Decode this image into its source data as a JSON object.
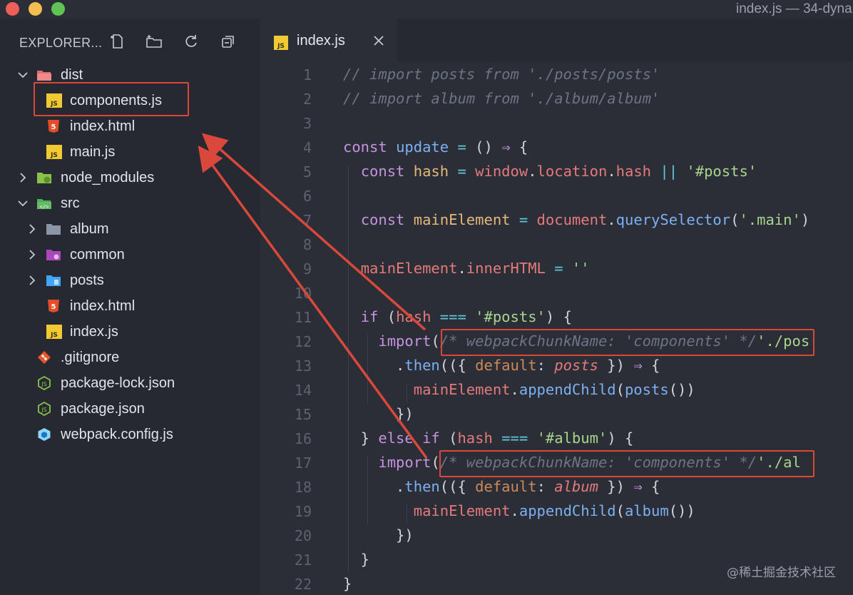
{
  "window": {
    "title": "index.js — 34-dyna"
  },
  "explorer": {
    "title": "EXPLORER...",
    "tree": [
      {
        "label": "dist",
        "type": "folder",
        "expanded": true,
        "depth": 0
      },
      {
        "label": "components.js",
        "type": "js",
        "depth": 1,
        "highlighted": true
      },
      {
        "label": "index.html",
        "type": "html",
        "depth": 1
      },
      {
        "label": "main.js",
        "type": "js",
        "depth": 1
      },
      {
        "label": "node_modules",
        "type": "folder",
        "expanded": false,
        "depth": 0
      },
      {
        "label": "src",
        "type": "folder",
        "expanded": true,
        "depth": 0
      },
      {
        "label": "album",
        "type": "folder",
        "expanded": false,
        "depth": 1
      },
      {
        "label": "common",
        "type": "folder",
        "expanded": false,
        "depth": 1
      },
      {
        "label": "posts",
        "type": "folder",
        "expanded": false,
        "depth": 1
      },
      {
        "label": "index.html",
        "type": "html",
        "depth": 1
      },
      {
        "label": "index.js",
        "type": "js",
        "depth": 1
      },
      {
        "label": ".gitignore",
        "type": "git",
        "depth": 0
      },
      {
        "label": "package-lock.json",
        "type": "json",
        "depth": 0
      },
      {
        "label": "package.json",
        "type": "json",
        "depth": 0
      },
      {
        "label": "webpack.config.js",
        "type": "webpack",
        "depth": 0
      }
    ]
  },
  "editor": {
    "tab_label": "index.js",
    "line_numbers": [
      "1",
      "2",
      "3",
      "4",
      "5",
      "6",
      "7",
      "8",
      "9",
      "10",
      "11",
      "12",
      "13",
      "14",
      "15",
      "16",
      "17",
      "18",
      "19",
      "20",
      "21",
      "22"
    ]
  },
  "colors": {
    "annotation": "#d9483a",
    "js_badge": "#f0c933"
  },
  "watermark": "@稀土掘金技术社区"
}
